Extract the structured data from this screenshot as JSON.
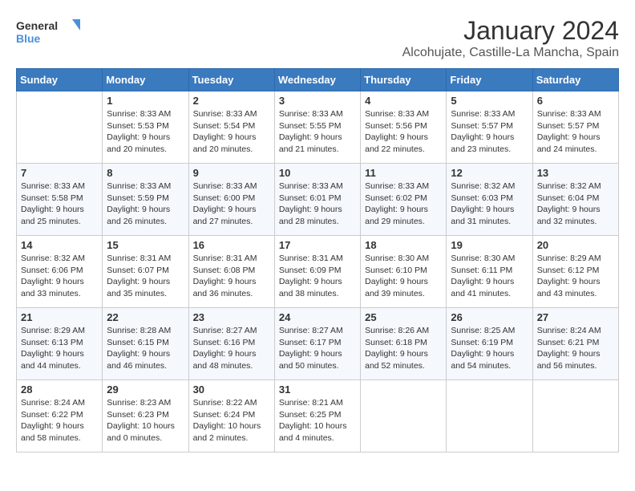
{
  "logo": {
    "line1": "General",
    "line2": "Blue"
  },
  "title": "January 2024",
  "subtitle": "Alcohujate, Castille-La Mancha, Spain",
  "header": {
    "accent_color": "#3a7abf"
  },
  "days_of_week": [
    "Sunday",
    "Monday",
    "Tuesday",
    "Wednesday",
    "Thursday",
    "Friday",
    "Saturday"
  ],
  "weeks": [
    [
      {
        "day": "",
        "sunrise": "",
        "sunset": "",
        "daylight": ""
      },
      {
        "day": "1",
        "sunrise": "Sunrise: 8:33 AM",
        "sunset": "Sunset: 5:53 PM",
        "daylight": "Daylight: 9 hours and 20 minutes."
      },
      {
        "day": "2",
        "sunrise": "Sunrise: 8:33 AM",
        "sunset": "Sunset: 5:54 PM",
        "daylight": "Daylight: 9 hours and 20 minutes."
      },
      {
        "day": "3",
        "sunrise": "Sunrise: 8:33 AM",
        "sunset": "Sunset: 5:55 PM",
        "daylight": "Daylight: 9 hours and 21 minutes."
      },
      {
        "day": "4",
        "sunrise": "Sunrise: 8:33 AM",
        "sunset": "Sunset: 5:56 PM",
        "daylight": "Daylight: 9 hours and 22 minutes."
      },
      {
        "day": "5",
        "sunrise": "Sunrise: 8:33 AM",
        "sunset": "Sunset: 5:57 PM",
        "daylight": "Daylight: 9 hours and 23 minutes."
      },
      {
        "day": "6",
        "sunrise": "Sunrise: 8:33 AM",
        "sunset": "Sunset: 5:57 PM",
        "daylight": "Daylight: 9 hours and 24 minutes."
      }
    ],
    [
      {
        "day": "7",
        "sunrise": "Sunrise: 8:33 AM",
        "sunset": "Sunset: 5:58 PM",
        "daylight": "Daylight: 9 hours and 25 minutes."
      },
      {
        "day": "8",
        "sunrise": "Sunrise: 8:33 AM",
        "sunset": "Sunset: 5:59 PM",
        "daylight": "Daylight: 9 hours and 26 minutes."
      },
      {
        "day": "9",
        "sunrise": "Sunrise: 8:33 AM",
        "sunset": "Sunset: 6:00 PM",
        "daylight": "Daylight: 9 hours and 27 minutes."
      },
      {
        "day": "10",
        "sunrise": "Sunrise: 8:33 AM",
        "sunset": "Sunset: 6:01 PM",
        "daylight": "Daylight: 9 hours and 28 minutes."
      },
      {
        "day": "11",
        "sunrise": "Sunrise: 8:33 AM",
        "sunset": "Sunset: 6:02 PM",
        "daylight": "Daylight: 9 hours and 29 minutes."
      },
      {
        "day": "12",
        "sunrise": "Sunrise: 8:32 AM",
        "sunset": "Sunset: 6:03 PM",
        "daylight": "Daylight: 9 hours and 31 minutes."
      },
      {
        "day": "13",
        "sunrise": "Sunrise: 8:32 AM",
        "sunset": "Sunset: 6:04 PM",
        "daylight": "Daylight: 9 hours and 32 minutes."
      }
    ],
    [
      {
        "day": "14",
        "sunrise": "Sunrise: 8:32 AM",
        "sunset": "Sunset: 6:06 PM",
        "daylight": "Daylight: 9 hours and 33 minutes."
      },
      {
        "day": "15",
        "sunrise": "Sunrise: 8:31 AM",
        "sunset": "Sunset: 6:07 PM",
        "daylight": "Daylight: 9 hours and 35 minutes."
      },
      {
        "day": "16",
        "sunrise": "Sunrise: 8:31 AM",
        "sunset": "Sunset: 6:08 PM",
        "daylight": "Daylight: 9 hours and 36 minutes."
      },
      {
        "day": "17",
        "sunrise": "Sunrise: 8:31 AM",
        "sunset": "Sunset: 6:09 PM",
        "daylight": "Daylight: 9 hours and 38 minutes."
      },
      {
        "day": "18",
        "sunrise": "Sunrise: 8:30 AM",
        "sunset": "Sunset: 6:10 PM",
        "daylight": "Daylight: 9 hours and 39 minutes."
      },
      {
        "day": "19",
        "sunrise": "Sunrise: 8:30 AM",
        "sunset": "Sunset: 6:11 PM",
        "daylight": "Daylight: 9 hours and 41 minutes."
      },
      {
        "day": "20",
        "sunrise": "Sunrise: 8:29 AM",
        "sunset": "Sunset: 6:12 PM",
        "daylight": "Daylight: 9 hours and 43 minutes."
      }
    ],
    [
      {
        "day": "21",
        "sunrise": "Sunrise: 8:29 AM",
        "sunset": "Sunset: 6:13 PM",
        "daylight": "Daylight: 9 hours and 44 minutes."
      },
      {
        "day": "22",
        "sunrise": "Sunrise: 8:28 AM",
        "sunset": "Sunset: 6:15 PM",
        "daylight": "Daylight: 9 hours and 46 minutes."
      },
      {
        "day": "23",
        "sunrise": "Sunrise: 8:27 AM",
        "sunset": "Sunset: 6:16 PM",
        "daylight": "Daylight: 9 hours and 48 minutes."
      },
      {
        "day": "24",
        "sunrise": "Sunrise: 8:27 AM",
        "sunset": "Sunset: 6:17 PM",
        "daylight": "Daylight: 9 hours and 50 minutes."
      },
      {
        "day": "25",
        "sunrise": "Sunrise: 8:26 AM",
        "sunset": "Sunset: 6:18 PM",
        "daylight": "Daylight: 9 hours and 52 minutes."
      },
      {
        "day": "26",
        "sunrise": "Sunrise: 8:25 AM",
        "sunset": "Sunset: 6:19 PM",
        "daylight": "Daylight: 9 hours and 54 minutes."
      },
      {
        "day": "27",
        "sunrise": "Sunrise: 8:24 AM",
        "sunset": "Sunset: 6:21 PM",
        "daylight": "Daylight: 9 hours and 56 minutes."
      }
    ],
    [
      {
        "day": "28",
        "sunrise": "Sunrise: 8:24 AM",
        "sunset": "Sunset: 6:22 PM",
        "daylight": "Daylight: 9 hours and 58 minutes."
      },
      {
        "day": "29",
        "sunrise": "Sunrise: 8:23 AM",
        "sunset": "Sunset: 6:23 PM",
        "daylight": "Daylight: 10 hours and 0 minutes."
      },
      {
        "day": "30",
        "sunrise": "Sunrise: 8:22 AM",
        "sunset": "Sunset: 6:24 PM",
        "daylight": "Daylight: 10 hours and 2 minutes."
      },
      {
        "day": "31",
        "sunrise": "Sunrise: 8:21 AM",
        "sunset": "Sunset: 6:25 PM",
        "daylight": "Daylight: 10 hours and 4 minutes."
      },
      {
        "day": "",
        "sunrise": "",
        "sunset": "",
        "daylight": ""
      },
      {
        "day": "",
        "sunrise": "",
        "sunset": "",
        "daylight": ""
      },
      {
        "day": "",
        "sunrise": "",
        "sunset": "",
        "daylight": ""
      }
    ]
  ]
}
